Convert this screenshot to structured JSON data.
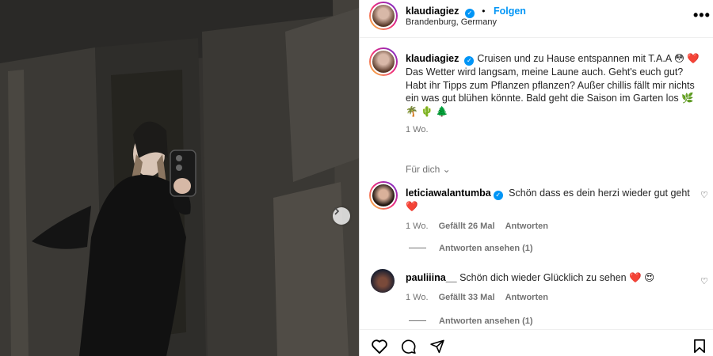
{
  "post": {
    "username": "klaudiagiez",
    "follow_label": "Folgen",
    "separator": "•",
    "location": "Brandenburg, Germany",
    "more_label": "•••"
  },
  "caption": {
    "username": "klaudiagiez",
    "text": "Cruisen und zu Hause entspannen mit T.A.A 😳 ❤️ Das Wetter wird langsam, meine Laune auch. Geht's euch gut? Habt ihr Tipps zum Pflanzen pflanzen? Außer chillis fällt mir nichts ein was gut blühen könnte. Bald geht die Saison im Garten los 🌿 🌴 🌵 🌲",
    "time": "1 Wo."
  },
  "fuer_dich": "Für dich ⌄",
  "comments": [
    {
      "username": "leticiawalantumba",
      "text": "Schön dass es dein herzi wieder gut geht ❤️",
      "time": "1 Wo.",
      "likes": "Gefällt 26 Mal",
      "reply_label": "Antworten",
      "view_replies": "Antworten ansehen (1)"
    },
    {
      "username": "pauliiina__",
      "text": "Schön dich wieder Glücklich zu sehen ❤️ 😍",
      "time": "1 Wo.",
      "likes": "Gefällt 33 Mal",
      "reply_label": "Antworten",
      "view_replies": "Antworten ansehen (1)"
    }
  ],
  "icons": [
    "heart-icon",
    "comment-icon",
    "share-icon",
    "bookmark-icon",
    "chevron-right-icon",
    "verified-icon"
  ],
  "colors": {
    "accent": "#0095f6",
    "muted": "#737373",
    "heart": "#ff3b69"
  }
}
